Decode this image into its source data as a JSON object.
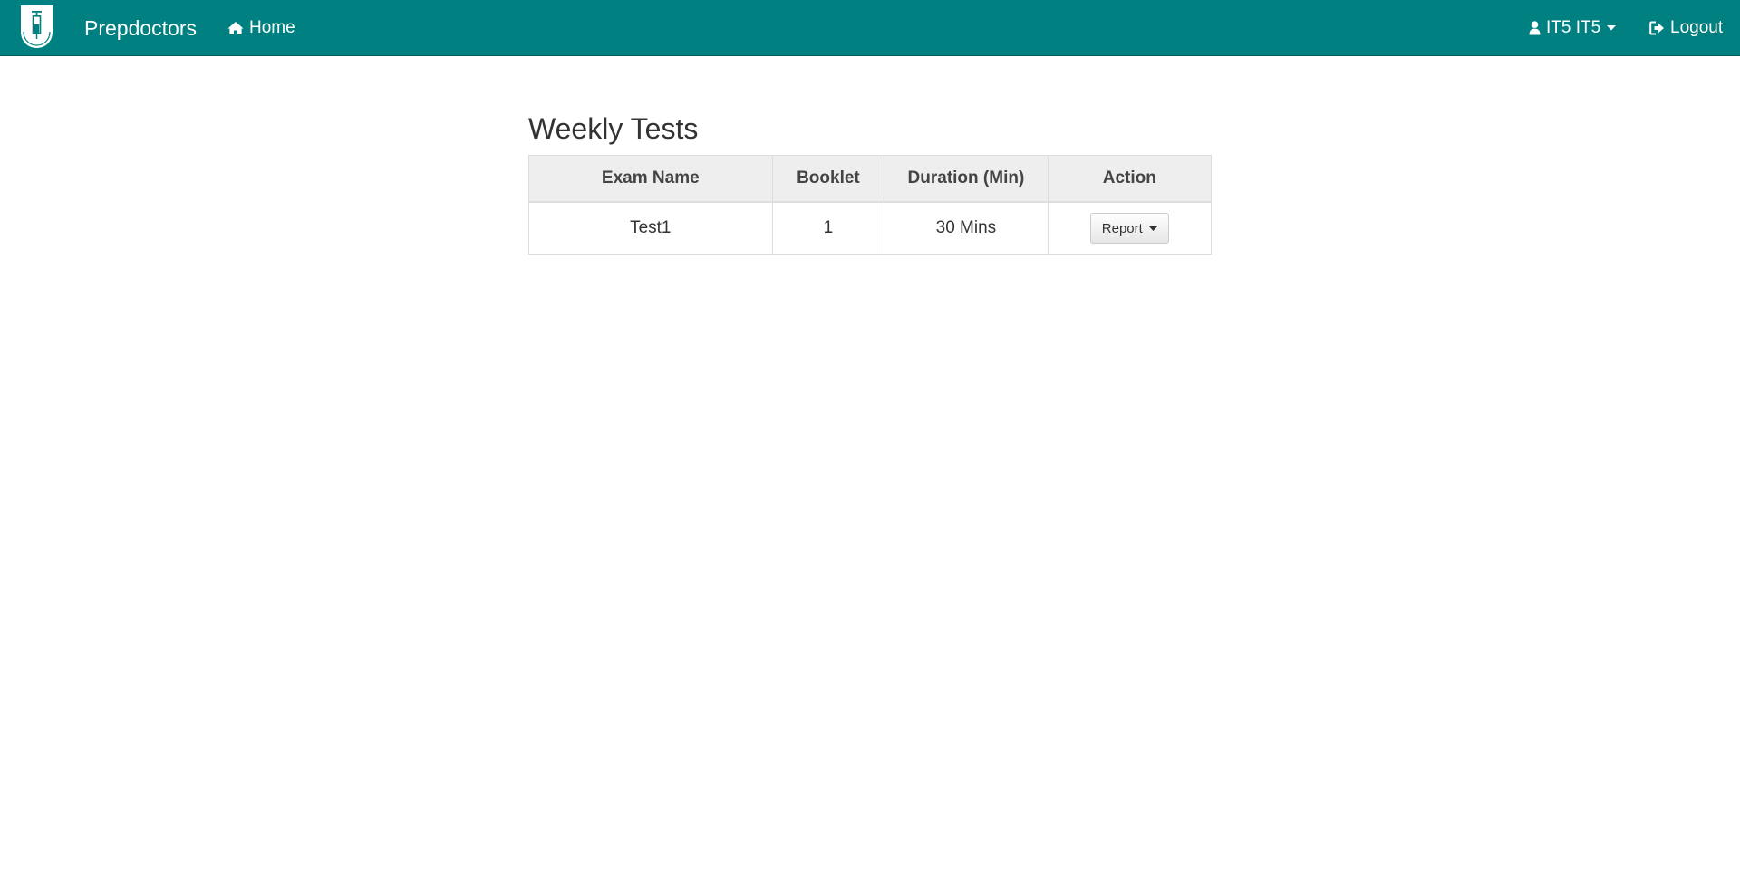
{
  "navbar": {
    "brand": "Prepdoctors",
    "home_label": "Home",
    "user_label": "IT5 IT5",
    "logout_label": "Logout",
    "background_color": "#008080",
    "icons": {
      "logo": "syringe-shield-logo",
      "home": "home-icon",
      "user": "user-icon",
      "user_menu": "caret-down-icon",
      "logout": "sign-out-icon"
    }
  },
  "main": {
    "title": "Weekly Tests",
    "table": {
      "columns": [
        "Exam Name",
        "Booklet",
        "Duration (Min)",
        "Action"
      ],
      "rows": [
        {
          "exam_name": "Test1",
          "booklet": "1",
          "duration": "30 Mins",
          "action_label": "Report"
        }
      ]
    }
  }
}
